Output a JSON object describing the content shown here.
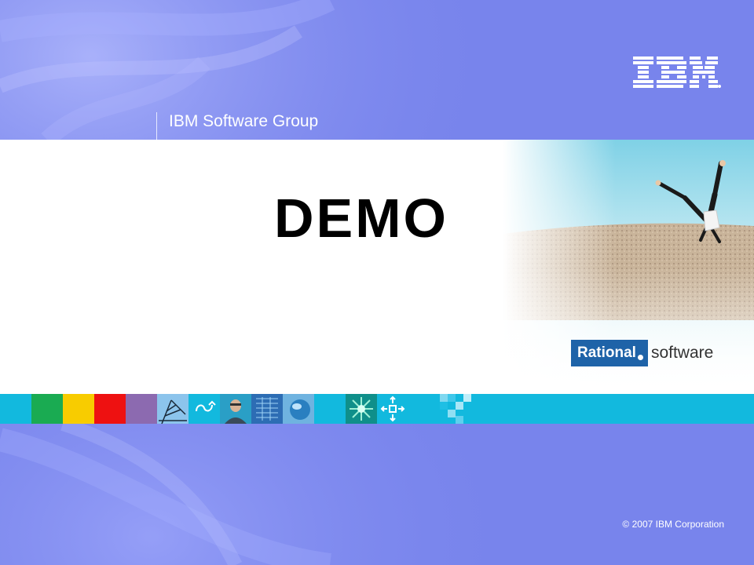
{
  "header": {
    "logo_text": "IBM",
    "group_label": "IBM Software Group"
  },
  "main": {
    "title": "DEMO"
  },
  "brand_badge": {
    "brand": "Rational",
    "product": "software"
  },
  "footer": {
    "copyright": "© 2007 IBM Corporation"
  },
  "colors": {
    "background": "#7a86ee",
    "strip_cyan": "#12b9de",
    "green": "#1aab52",
    "yellow": "#f8cc00",
    "red": "#ee1111",
    "purple": "#8c6ab0",
    "rational_blue": "#1e63a8"
  },
  "icons": [
    "ibm-logo-icon",
    "photo-cartwheel-person",
    "crane-icon",
    "cycle-arrow-icon",
    "person-photo-icon",
    "grid-screen-icon",
    "sphere-icon",
    "starburst-icon",
    "move-arrows-icon",
    "pixel-blocks-icon"
  ]
}
